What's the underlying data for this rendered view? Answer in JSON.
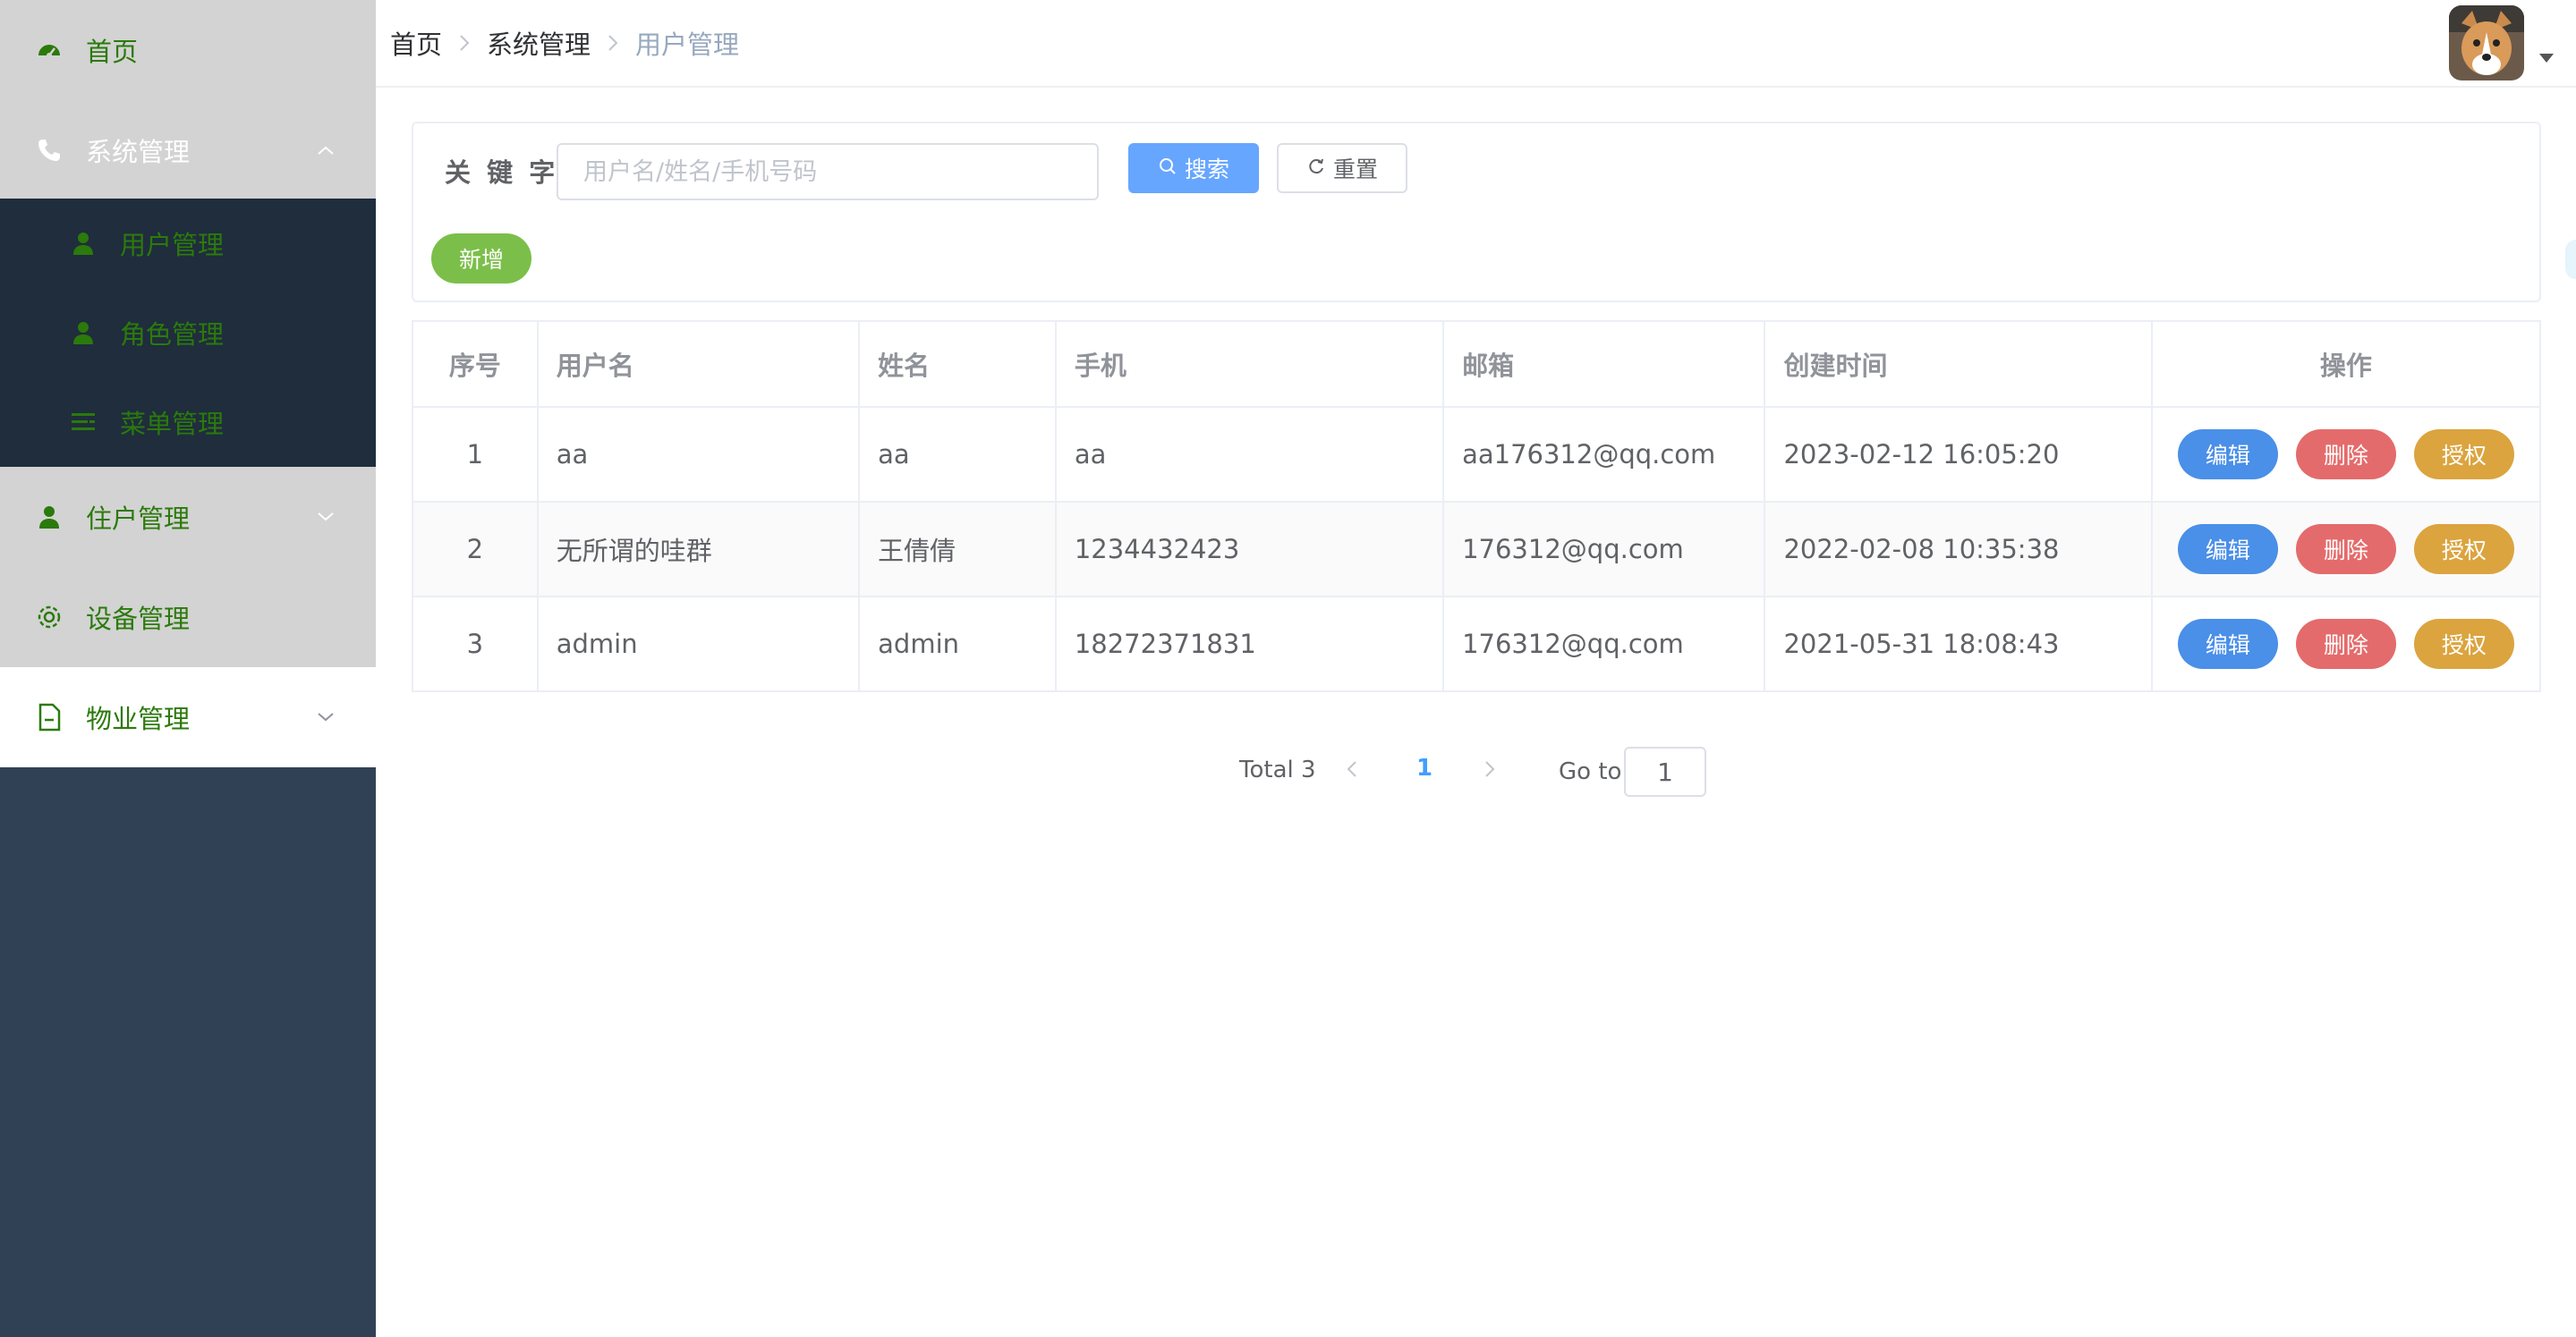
{
  "sidebar": {
    "home": "首页",
    "system": "系统管理",
    "system_sub": {
      "user": "用户管理",
      "role": "角色管理",
      "menu": "菜单管理"
    },
    "resident": "住户管理",
    "device": "设备管理",
    "property": "物业管理"
  },
  "breadcrumb": [
    "首页",
    "系统管理",
    "用户管理"
  ],
  "filter": {
    "keyword_label": "关 键 字",
    "keyword_placeholder": "用户名/姓名/手机号码",
    "keyword_value": "",
    "search_label": "搜索",
    "reset_label": "重置",
    "add_label": "新增"
  },
  "table": {
    "columns": [
      "序号",
      "用户名",
      "姓名",
      "手机",
      "邮箱",
      "创建时间",
      "操作"
    ],
    "rows": [
      {
        "index": "1",
        "username": "aa",
        "name": "aa",
        "phone": "aa",
        "email": "aa176312@qq.com",
        "created": "2023-02-12 16:05:20"
      },
      {
        "index": "2",
        "username": "无所谓的哇群",
        "name": "王倩倩",
        "phone": "1234432423",
        "email": "176312@qq.com",
        "created": "2022-02-08 10:35:38"
      },
      {
        "index": "3",
        "username": "admin",
        "name": "admin",
        "phone": "18272371831",
        "email": "176312@qq.com",
        "created": "2021-05-31 18:08:43"
      }
    ],
    "actions": {
      "edit": "编辑",
      "delete": "删除",
      "auth": "授权"
    }
  },
  "pagination": {
    "total_text": "Total 3",
    "current_page": "1",
    "goto_label": "Go to",
    "goto_value": "1"
  },
  "colors": {
    "sidebar_bg": "#304156",
    "submenu_bg": "#1f2d3d",
    "menu_text": "#2b7a0b",
    "primary": "#66a6ff",
    "edit": "#4a8fe8",
    "delete": "#e46b6b",
    "auth": "#dba43f",
    "add": "#7bbf4a"
  }
}
